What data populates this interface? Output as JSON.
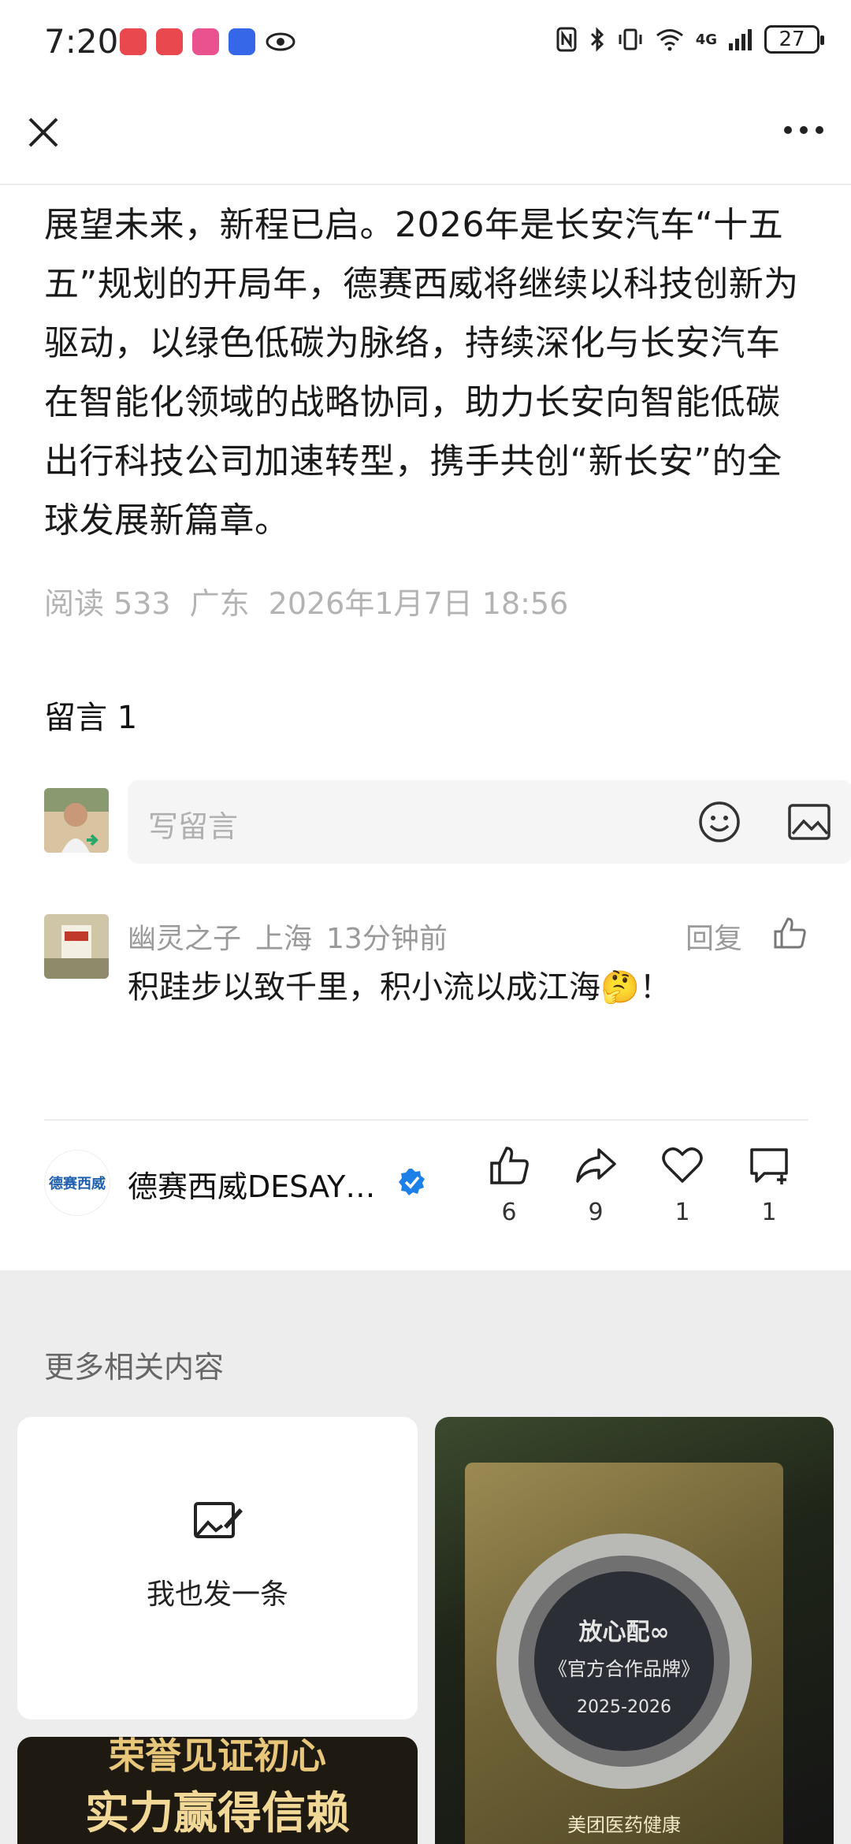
{
  "status_bar": {
    "time": "7:20",
    "network": "4G",
    "battery": "27"
  },
  "article": {
    "body": "展望未来，新程已启。2026年是长安汽车“十五五”规划的开局年，德赛西威将继续以科技创新为驱动，以绿色低碳为脉络，持续深化与长安汽车在智能化领域的战略协同，助力长安向智能低碳出行科技公司加速转型，携手共创“新长安”的全球发展新篇章。",
    "reads": "阅读 533",
    "location": "广东",
    "datetime": "2026年1月7日 18:56"
  },
  "comments": {
    "title": "留言 1",
    "input_placeholder": "写留言",
    "items": [
      {
        "author": "幽灵之子",
        "location": "上海",
        "time": "13分钟前",
        "text": "积跬步以致千里，积小流以成江海🤔！",
        "reply_label": "回复"
      }
    ]
  },
  "author_bar": {
    "name": "德赛西威DESAY…",
    "logo_text": "德赛西威",
    "likes": "6",
    "shares": "9",
    "favorites": "1",
    "comments": "1"
  },
  "related": {
    "title": "更多相关内容",
    "post_label": "我也发一条",
    "promo_line1": "荣誉见证初心",
    "promo_line2": "实力赢得信赖",
    "plaque_brand": "放心配∞",
    "plaque_badge": "《官方合作品牌》",
    "plaque_years": "2025-2026",
    "plaque_footer": "美团医药健康"
  },
  "colors": {
    "verified_blue": "#1d7fe8",
    "muted_text": "#9a9a9a",
    "related_bg": "#ededed"
  }
}
